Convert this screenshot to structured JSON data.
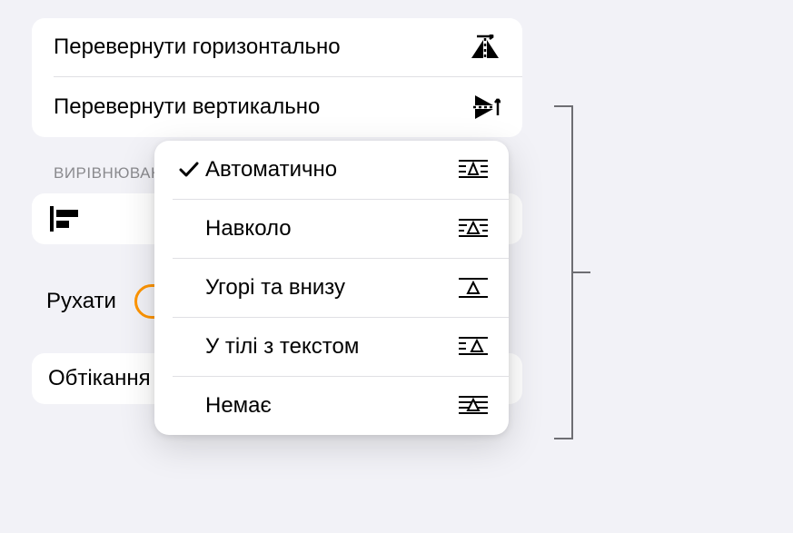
{
  "flip": {
    "horizontal": "Перевернути горизонтально",
    "vertical": "Перевернути вертикально"
  },
  "align": {
    "section_label": "ВИРІВНЮВАННЯ"
  },
  "move": {
    "label": "Рухати"
  },
  "wrap": {
    "label": "Обтікання текстом",
    "selected": "Автоматично"
  },
  "popup": {
    "options": [
      {
        "label": "Автоматично",
        "selected": true
      },
      {
        "label": "Навколо",
        "selected": false
      },
      {
        "label": "Угорі та внизу",
        "selected": false
      },
      {
        "label": "У тілі з текстом",
        "selected": false
      },
      {
        "label": "Немає",
        "selected": false
      }
    ]
  }
}
